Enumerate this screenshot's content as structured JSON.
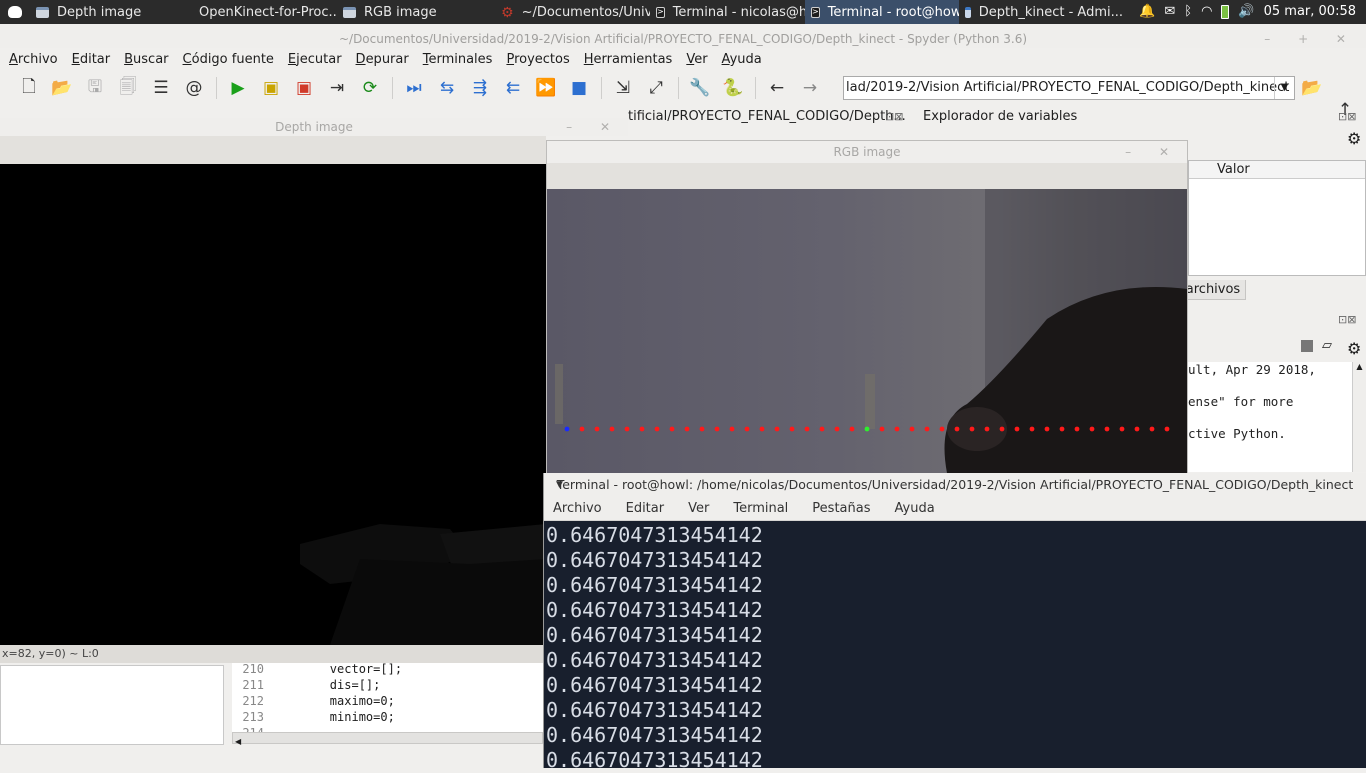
{
  "taskbar": {
    "items": [
      {
        "label": "Depth image",
        "icon": "window-icon",
        "active": false
      },
      {
        "label": "OpenKinect-for-Proc...",
        "icon": "firefox-icon",
        "active": false
      },
      {
        "label": "RGB image",
        "icon": "window-icon",
        "active": false
      },
      {
        "label": "~/Documentos/Univ...",
        "icon": "gear-icon",
        "active": false
      },
      {
        "label": "Terminal - nicolas@h...",
        "icon": "terminal-icon",
        "active": false
      },
      {
        "label": "Terminal - root@how...",
        "icon": "terminal-icon",
        "active": true
      },
      {
        "label": "Depth_kinect - Admi...",
        "icon": "file-manager-icon",
        "active": false
      }
    ],
    "clock": "05 mar, 00:58"
  },
  "spyder": {
    "title": "~/Documentos/Universidad/2019-2/Vision Artificial/PROYECTO_FENAL_CODIGO/Depth_kinect - Spyder (Python 3.6)",
    "menu": [
      "Archivo",
      "Editar",
      "Buscar",
      "Código fuente",
      "Ejecutar",
      "Depurar",
      "Terminales",
      "Proyectos",
      "Herramientas",
      "Ver",
      "Ayuda"
    ],
    "path": "lad/2019-2/Vision Artificial/PROYECTO_FENAL_CODIGO/Depth_kinect",
    "editor_tab_path": "tificial/PROYECTO_FENAL_CODIGO/Depth...",
    "variable_explorer": {
      "title": "Explorador de variables",
      "column": "Valor"
    },
    "files_tab": "archivos",
    "console_lines": [
      "ult, Apr 29 2018,",
      "",
      "ense\" for more",
      "",
      "ctive Python."
    ],
    "code": [
      {
        "n": "210",
        "text": "        vector=[];"
      },
      {
        "n": "211",
        "text": "        dis=[];"
      },
      {
        "n": "212",
        "text": "        maximo=0;"
      },
      {
        "n": "213",
        "text": "        minimo=0;"
      },
      {
        "n": "214",
        "text": ""
      }
    ]
  },
  "depth_window": {
    "title": "Depth image",
    "status": "x=82, y=0) ~ L:0"
  },
  "rgb_window": {
    "title": "RGB image",
    "point_colors": {
      "first": "#1a2bff",
      "marker": "#2ef02e",
      "rest": "#ff1a1a"
    }
  },
  "terminal": {
    "title": "Terminal - root@howl: /home/nicolas/Documentos/Universidad/2019-2/Vision Artificial/PROYECTO_FENAL_CODIGO/Depth_kinect",
    "menu": [
      "Archivo",
      "Editar",
      "Ver",
      "Terminal",
      "Pestañas",
      "Ayuda"
    ],
    "lines": [
      "0.6467047313454142",
      "0.6467047313454142",
      "0.6467047313454142",
      "0.6467047313454142",
      "0.6467047313454142",
      "0.6467047313454142",
      "0.6467047313454142",
      "0.6467047313454142",
      "0.6467047313454142",
      "0.6467047313454142"
    ]
  }
}
